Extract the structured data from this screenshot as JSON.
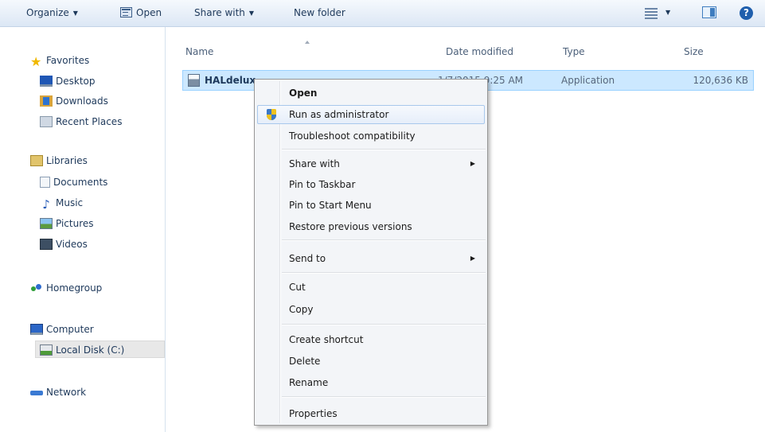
{
  "toolbar": {
    "organize": "Organize",
    "open": "Open",
    "share_with": "Share with",
    "new_folder": "New folder",
    "help": "?"
  },
  "nav": {
    "favorites": "Favorites",
    "desktop": "Desktop",
    "downloads": "Downloads",
    "recent_places": "Recent Places",
    "libraries": "Libraries",
    "documents": "Documents",
    "music": "Music",
    "pictures": "Pictures",
    "videos": "Videos",
    "homegroup": "Homegroup",
    "computer": "Computer",
    "local_disk": "Local Disk (C:)",
    "network": "Network"
  },
  "columns": {
    "name": "Name",
    "date_modified": "Date modified",
    "type": "Type",
    "size": "Size"
  },
  "file": {
    "name": "HALdelux",
    "date": "1/7/2015 9:25 AM",
    "type": "Application",
    "size": "120,636 KB"
  },
  "context_menu": {
    "open": "Open",
    "run_as_admin": "Run as administrator",
    "troubleshoot": "Troubleshoot compatibility",
    "share_with": "Share with",
    "pin_taskbar": "Pin to Taskbar",
    "pin_start": "Pin to Start Menu",
    "restore": "Restore previous versions",
    "send_to": "Send to",
    "cut": "Cut",
    "copy": "Copy",
    "create_shortcut": "Create shortcut",
    "delete": "Delete",
    "rename": "Rename",
    "properties": "Properties"
  }
}
